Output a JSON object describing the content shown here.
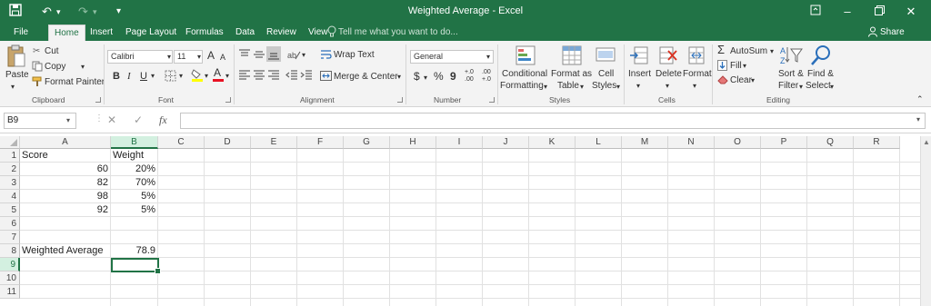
{
  "titlebar": {
    "title": "Weighted Average - Excel",
    "icons": [
      "save-icon",
      "undo-icon",
      "redo-icon",
      "customize-qat-icon"
    ],
    "window_controls": [
      "ribbon-display-icon",
      "minimize-icon",
      "restore-icon",
      "close-icon"
    ]
  },
  "tabs": [
    "File",
    "Home",
    "Insert",
    "Page Layout",
    "Formulas",
    "Data",
    "Review",
    "View"
  ],
  "active_tab": "Home",
  "tell_me": "Tell me what you want to do...",
  "share": "Share",
  "ribbon": {
    "clipboard": {
      "paste": "Paste",
      "cut": "Cut",
      "copy": "Copy",
      "format_painter": "Format Painter",
      "label": "Clipboard"
    },
    "font": {
      "name": "Calibri",
      "size": "11",
      "bold": "B",
      "italic": "I",
      "underline": "U",
      "grow": "A",
      "shrink": "A",
      "font_color": "A",
      "label": "Font"
    },
    "alignment": {
      "wrap_text": "Wrap Text",
      "merge_center": "Merge & Center",
      "label": "Alignment"
    },
    "number": {
      "format": "General",
      "currency": "$",
      "percent": "%",
      "comma": "9",
      "inc_decimal": "+.0 .00",
      "dec_decimal": ".00 +.0",
      "label": "Number"
    },
    "styles": {
      "conditional": [
        "Conditional",
        "Formatting"
      ],
      "format_as": [
        "Format as",
        "Table"
      ],
      "cell": [
        "Cell",
        "Styles"
      ],
      "label": "Styles"
    },
    "cells": {
      "insert": "Insert",
      "delete": "Delete",
      "format": "Format",
      "label": "Cells"
    },
    "editing": {
      "autosum": "AutoSum",
      "fill": "Fill",
      "clear": "Clear",
      "sort": [
        "Sort &",
        "Filter"
      ],
      "find": [
        "Find &",
        "Select"
      ],
      "label": "Editing"
    }
  },
  "formula_bar": {
    "name_box": "B9",
    "cancel": "✕",
    "enter": "✓",
    "fx": "fx",
    "formula": ""
  },
  "sheet": {
    "columns": [
      "A",
      "B",
      "C",
      "D",
      "E",
      "F",
      "G",
      "H",
      "I",
      "J",
      "K",
      "L",
      "M",
      "N",
      "O",
      "P",
      "Q",
      "R"
    ],
    "rows": [
      "1",
      "2",
      "3",
      "4",
      "5",
      "6",
      "7",
      "8",
      "9",
      "10",
      "11"
    ],
    "cells": {
      "A1": "Score",
      "B1": "Weight",
      "A2": "60",
      "B2": "20%",
      "A3": "82",
      "B3": "70%",
      "A4": "98",
      "B4": "5%",
      "A5": "92",
      "B5": "5%",
      "A8": "Weighted Average",
      "B8": "78.9"
    },
    "selected_cell": "B9"
  },
  "colors": {
    "accent": "#217346",
    "ribbon_bg": "#f3f3f3",
    "header_bg": "#f2f2f2",
    "gridline": "#e1e1e1"
  }
}
